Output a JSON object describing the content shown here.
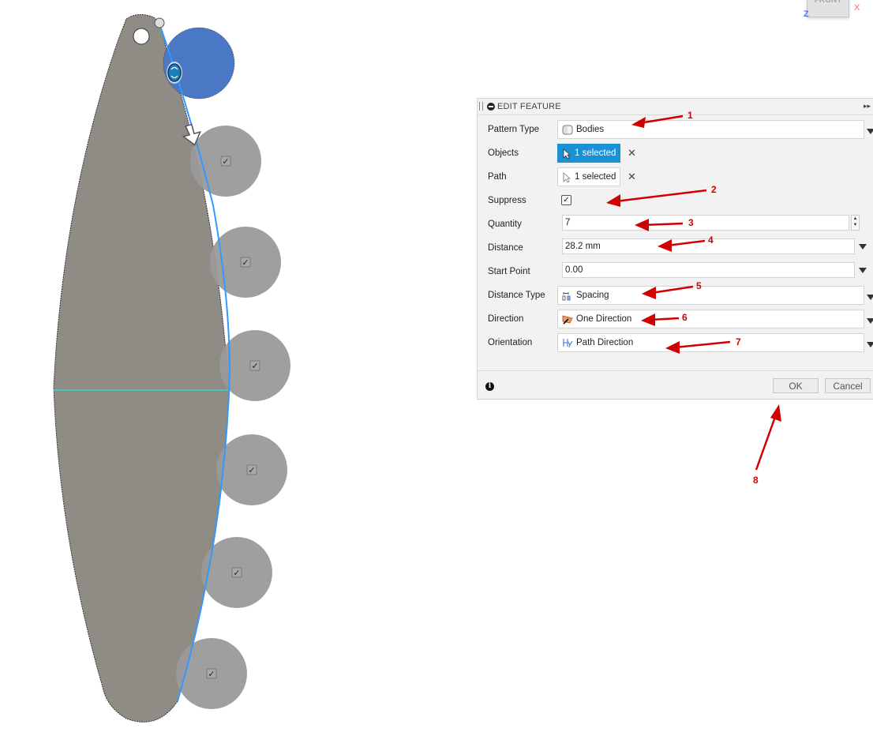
{
  "viewcube": {
    "face_label": "FRONT",
    "axis_z": "Z",
    "axis_x": "X"
  },
  "panel": {
    "title": "EDIT FEATURE",
    "rows": {
      "pattern_type": {
        "label": "Pattern Type",
        "value": "Bodies",
        "icon": "body-icon"
      },
      "objects": {
        "label": "Objects",
        "value": "1 selected",
        "icon": "cursor-icon",
        "active": true
      },
      "path": {
        "label": "Path",
        "value": "1 selected",
        "icon": "cursor-icon",
        "active": false
      },
      "suppress": {
        "label": "Suppress",
        "checked": true,
        "check_glyph": "✓"
      },
      "quantity": {
        "label": "Quantity",
        "value": "7"
      },
      "distance": {
        "label": "Distance",
        "value": "28.2 mm"
      },
      "start_point": {
        "label": "Start Point",
        "value": "0.00"
      },
      "distance_type": {
        "label": "Distance Type",
        "value": "Spacing",
        "icon": "spacing-icon"
      },
      "direction": {
        "label": "Direction",
        "value": "One Direction",
        "icon": "one-direction-icon"
      },
      "orientation": {
        "label": "Orientation",
        "value": "Path Direction",
        "icon": "path-direction-icon"
      }
    },
    "clear_glyph": "✕",
    "spin_up": "▲",
    "spin_down": "▼",
    "info_glyph": "i",
    "expand_glyph": "▸▸",
    "ok_label": "OK",
    "cancel_label": "Cancel"
  },
  "annotations": [
    "1",
    "2",
    "3",
    "4",
    "5",
    "6",
    "7",
    "8"
  ],
  "colors": {
    "accent": "#1a90d5",
    "annotation": "#d10000",
    "body": "#8f8b85",
    "pattern_instance": "#9a9a9a",
    "source_body": "#4a78c4",
    "path": "#3399ff",
    "centerline": "#30d8c8"
  },
  "canvas": {
    "instance_check_glyph": "✓",
    "instance_count": 6
  }
}
